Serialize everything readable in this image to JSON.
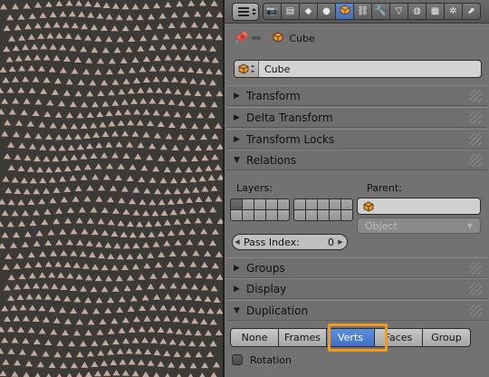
{
  "header": {
    "context_tab_icons": [
      "render-icon",
      "render-layers-icon",
      "scene-icon",
      "world-icon",
      "object-icon",
      "constraints-icon",
      "modifiers-icon",
      "data-icon",
      "material-icon",
      "texture-icon",
      "particles-icon",
      "physics-icon"
    ],
    "active_tab_index": 4
  },
  "breadcrumb": {
    "object": "Cube"
  },
  "object_field": {
    "name": "Cube"
  },
  "panels": {
    "transform": "Transform",
    "delta_transform": "Delta Transform",
    "transform_locks": "Transform Locks",
    "relations": "Relations",
    "groups": "Groups",
    "display": "Display",
    "duplication": "Duplication"
  },
  "relations": {
    "layers_label": "Layers:",
    "parent_label": "Parent:",
    "parent_type": "Object",
    "pass_index_label": "Pass Index:",
    "pass_index_value": "0"
  },
  "duplication": {
    "options": [
      "None",
      "Frames",
      "Verts",
      "Faces",
      "Group"
    ],
    "selected": "Verts",
    "rotation_label": "Rotation",
    "rotation_checked": false
  },
  "colors": {
    "accent": "#4f81d0",
    "highlight": "#f39a1a",
    "viewport_bg": "#3c3a37",
    "marker": "#d9bfb0"
  }
}
